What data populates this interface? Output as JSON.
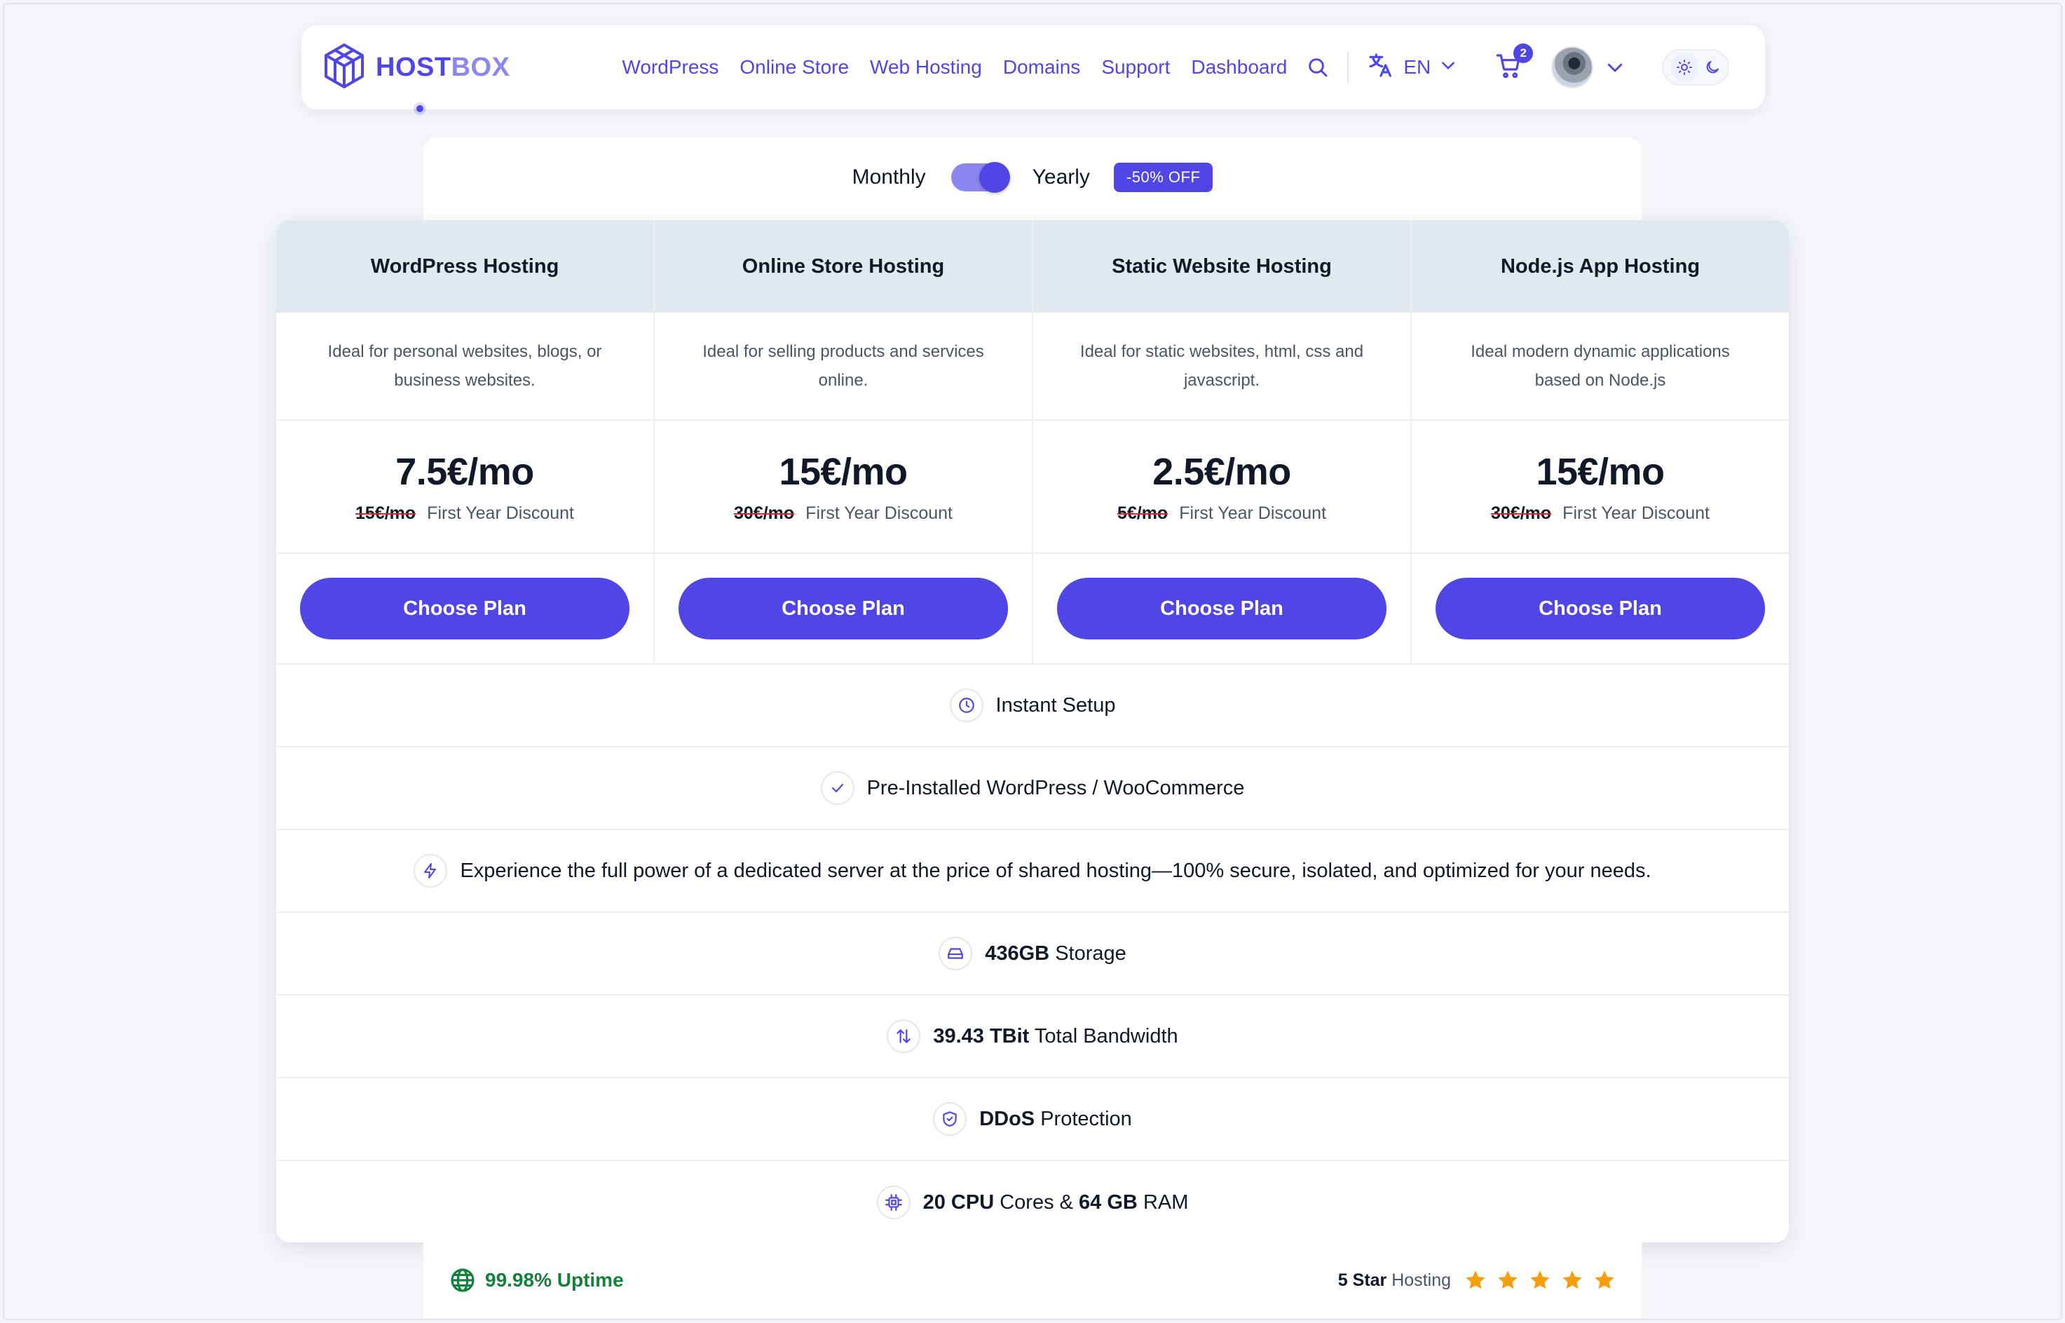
{
  "brand": {
    "part1": "HOST",
    "part2": "BOX"
  },
  "nav": {
    "links": [
      "WordPress",
      "Online Store",
      "Web Hosting",
      "Domains",
      "Support",
      "Dashboard"
    ],
    "language": "EN",
    "cart_count": "2"
  },
  "billing": {
    "monthly_label": "Monthly",
    "yearly_label": "Yearly",
    "discount_badge": "-50% OFF",
    "selected": "yearly"
  },
  "plans": [
    {
      "name": "WordPress Hosting",
      "description": "Ideal for personal websites, blogs, or business websites.",
      "price": "7.5€/mo",
      "old_price": "15€/mo",
      "discount_note": "First Year Discount",
      "cta": "Choose Plan"
    },
    {
      "name": "Online Store Hosting",
      "description": "Ideal for selling products and services online.",
      "price": "15€/mo",
      "old_price": "30€/mo",
      "discount_note": "First Year Discount",
      "cta": "Choose Plan"
    },
    {
      "name": "Static Website Hosting",
      "description": "Ideal for static websites, html, css and javascript.",
      "price": "2.5€/mo",
      "old_price": "5€/mo",
      "discount_note": "First Year Discount",
      "cta": "Choose Plan"
    },
    {
      "name": "Node.js App Hosting",
      "description": "Ideal modern dynamic applications based on Node.js",
      "price": "15€/mo",
      "old_price": "30€/mo",
      "discount_note": "First Year Discount",
      "cta": "Choose Plan"
    }
  ],
  "features": {
    "instant_setup": "Instant Setup",
    "preinstalled": "Pre-Installed WordPress / WooCommerce",
    "power": "Experience the full power of a dedicated server at the price of shared hosting—100% secure, isolated, and optimized for your needs.",
    "storage_value": "436GB",
    "storage_label": "Storage",
    "bandwidth_value": "39.43 TBit",
    "bandwidth_label": "Total Bandwidth",
    "ddos_value": "DDoS",
    "ddos_label": "Protection",
    "cpu_value": "20 CPU",
    "cpu_mid": "Cores &",
    "ram_value": "64 GB",
    "ram_label": "RAM"
  },
  "footer": {
    "uptime": "99.98% Uptime",
    "rating_value": "5 Star",
    "rating_label": "Hosting",
    "stars": 5
  },
  "colors": {
    "accent": "#4f46e5",
    "accent_light": "#8b86f0",
    "header_row": "#e2e8f0",
    "uptime_green": "#15803d",
    "star": "#f59e0b",
    "strike": "#dc2626"
  }
}
